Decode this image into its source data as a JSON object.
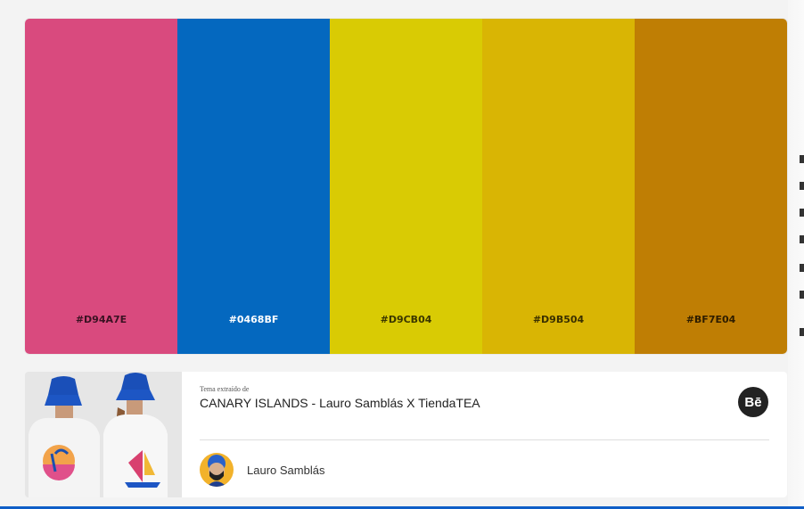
{
  "palette": [
    {
      "hex": "#D94A7E",
      "label": "#D94A7E",
      "text_color": "#3a1222"
    },
    {
      "hex": "#0468BF",
      "label": "#0468BF",
      "text_color": "#ffffff"
    },
    {
      "hex": "#D9CB04",
      "label": "#D9CB04",
      "text_color": "#3a3600"
    },
    {
      "hex": "#D9B504",
      "label": "#D9B504",
      "text_color": "#3a3000"
    },
    {
      "hex": "#BF7E04",
      "label": "#BF7E04",
      "text_color": "#2e1d00"
    }
  ],
  "source": {
    "caption": "Tema extraído de",
    "title": "CANARY ISLANDS - Lauro Samblás X TiendaTEA",
    "service_button_label": "Bē",
    "author_name": "Lauro Samblás"
  },
  "colors": {
    "accent_bar": "#0f5ec7",
    "page_bg": "#f3f3f3"
  },
  "icons": [
    "behance-icon",
    "author-avatar"
  ]
}
